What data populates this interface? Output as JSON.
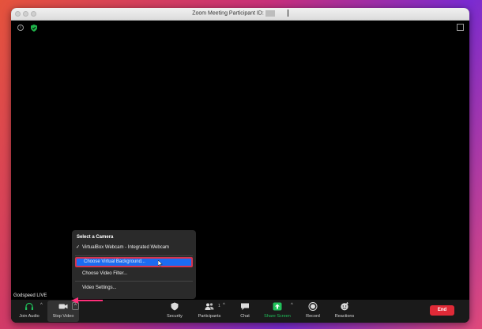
{
  "window": {
    "title": "Zoom Meeting Participant ID:"
  },
  "video": {
    "participant_name": "Godspeed LIVE"
  },
  "camera_menu": {
    "header": "Select a Camera",
    "items": [
      {
        "label": "VirtualBox Webcam - Integrated Webcam",
        "checked": true
      },
      {
        "label": "Choose Virtual Background...",
        "highlighted": true
      },
      {
        "label": "Choose Video Filter..."
      },
      {
        "label": "Video Settings..."
      }
    ]
  },
  "toolbar": {
    "join_audio": "Join Audio",
    "stop_video": "Stop Video",
    "security": "Security",
    "participants": "Participants",
    "participants_count": "1",
    "chat": "Chat",
    "share_screen": "Share Screen",
    "record": "Record",
    "reactions": "Reactions",
    "end": "End"
  },
  "colors": {
    "highlight_blue": "#1b6cf2",
    "annotation_red": "#d8344e",
    "share_green": "#20c05a",
    "end_red": "#e02a37",
    "verified_green": "#1fb34a"
  },
  "icons": [
    "info-icon",
    "shield-check-icon",
    "fullscreen-icon",
    "headphones-icon",
    "video-camera-icon",
    "security-shield-icon",
    "participants-icon",
    "chat-bubble-icon",
    "share-screen-icon",
    "record-icon",
    "reactions-icon",
    "caret-up-icon",
    "mouse-pointer-icon",
    "pink-arrow-icon"
  ]
}
